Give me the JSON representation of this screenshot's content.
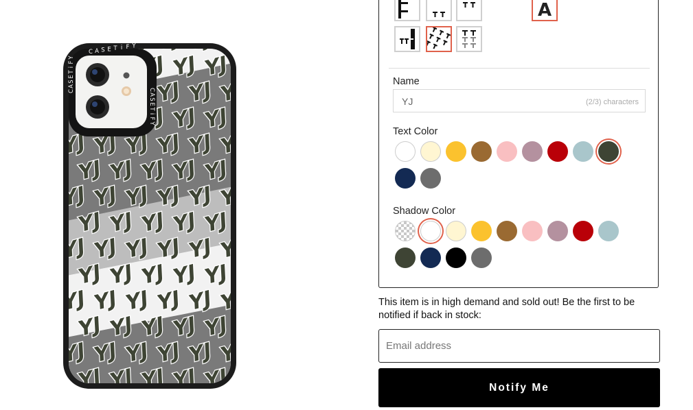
{
  "preview": {
    "monogram": "YJ",
    "brand_text": "CASETiFY",
    "pattern_color": "#3e4434"
  },
  "pattern_tiles": [
    {
      "icon": "stacked-t-pattern-icon",
      "selected": false
    },
    {
      "icon": "double-t-pattern-icon",
      "selected": false
    },
    {
      "icon": "double-t-top-pattern-icon",
      "selected": false
    },
    {
      "icon": "vertical-stripe-t-pattern-icon",
      "selected": false
    },
    {
      "icon": "diagonal-t-pattern-icon",
      "selected": true
    },
    {
      "icon": "grid-t-pattern-icon",
      "selected": false
    }
  ],
  "font_tile": {
    "glyph": "A",
    "icon": "font-a-icon",
    "selected": true
  },
  "name_section": {
    "label": "Name",
    "value": "YJ",
    "counter": "(2/3) characters"
  },
  "text_color": {
    "label": "Text Color",
    "swatches": [
      {
        "name": "white",
        "color": "#ffffff",
        "selected": false
      },
      {
        "name": "cream",
        "color": "#fff6d2",
        "selected": false
      },
      {
        "name": "yellow",
        "color": "#fbc22e",
        "selected": false
      },
      {
        "name": "brown",
        "color": "#9a6a32",
        "selected": false
      },
      {
        "name": "pink",
        "color": "#f9bfc1",
        "selected": false
      },
      {
        "name": "mauve",
        "color": "#b4919f",
        "selected": false
      },
      {
        "name": "red",
        "color": "#b90008",
        "selected": false
      },
      {
        "name": "light-blue",
        "color": "#a9c6cb",
        "selected": false
      },
      {
        "name": "olive",
        "color": "#3e4434",
        "selected": true
      },
      {
        "name": "navy",
        "color": "#132a53",
        "selected": false
      },
      {
        "name": "gray",
        "color": "#6d6d6d",
        "selected": false
      }
    ]
  },
  "shadow_color": {
    "label": "Shadow Color",
    "swatches": [
      {
        "name": "none",
        "color": "transparent",
        "selected": false
      },
      {
        "name": "white",
        "color": "#ffffff",
        "selected": true
      },
      {
        "name": "cream",
        "color": "#fff6d2",
        "selected": false
      },
      {
        "name": "yellow",
        "color": "#fbc22e",
        "selected": false
      },
      {
        "name": "brown",
        "color": "#9a6a32",
        "selected": false
      },
      {
        "name": "pink",
        "color": "#f9bfc1",
        "selected": false
      },
      {
        "name": "mauve",
        "color": "#b4919f",
        "selected": false
      },
      {
        "name": "red",
        "color": "#b90008",
        "selected": false
      },
      {
        "name": "light-blue",
        "color": "#a9c6cb",
        "selected": false
      },
      {
        "name": "olive",
        "color": "#3e4434",
        "selected": false
      },
      {
        "name": "navy",
        "color": "#132a53",
        "selected": false
      },
      {
        "name": "black",
        "color": "#000000",
        "selected": false
      },
      {
        "name": "gray",
        "color": "#6d6d6d",
        "selected": false
      }
    ]
  },
  "notify": {
    "message": "This item is in high demand and sold out! Be the first to be notified if back in stock:",
    "email_placeholder": "Email address",
    "button_label": "Notify Me"
  }
}
